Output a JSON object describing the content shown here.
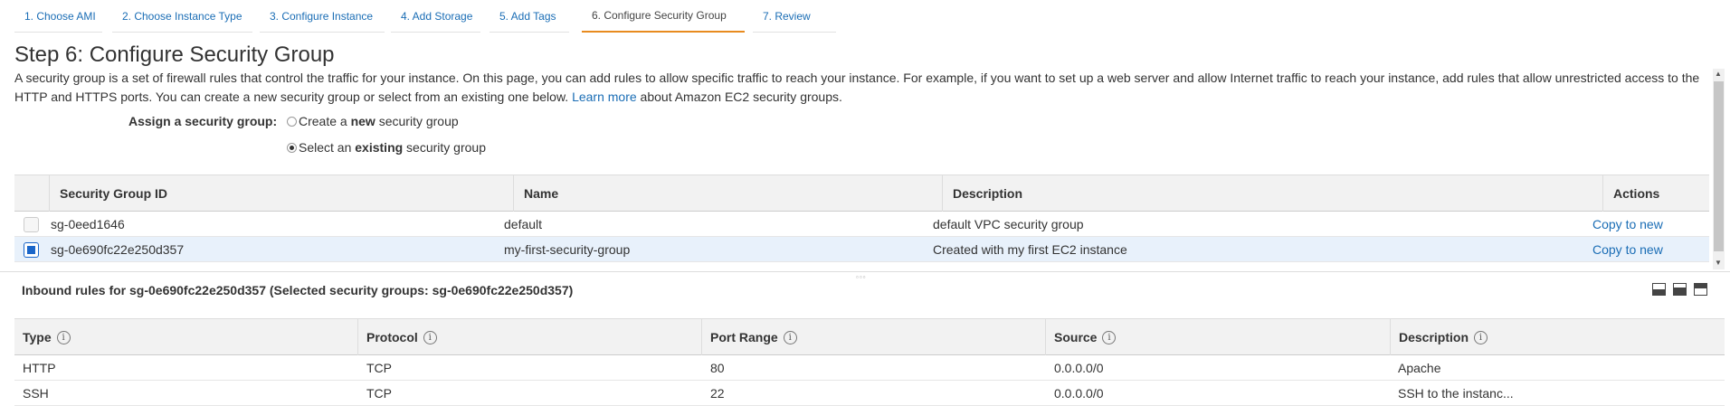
{
  "wizard": {
    "tabs": [
      {
        "label": "1. Choose AMI",
        "active": false
      },
      {
        "label": "2. Choose Instance Type",
        "active": false
      },
      {
        "label": "3. Configure Instance",
        "active": false
      },
      {
        "label": "4. Add Storage",
        "active": false
      },
      {
        "label": "5. Add Tags",
        "active": false
      },
      {
        "label": "6. Configure Security Group",
        "active": true
      },
      {
        "label": "7. Review",
        "active": false
      }
    ]
  },
  "page": {
    "title": "Step 6: Configure Security Group",
    "description_part1": "A security group is a set of firewall rules that control the traffic for your instance. On this page, you can add rules to allow specific traffic to reach your instance. For example, if you want to set up a web server and allow Internet traffic to reach your instance, add rules that allow unrestricted access to the HTTP and HTTPS ports. You can create a new security group or select from an existing one below.",
    "learn_more": "Learn more",
    "description_part2": "about Amazon EC2 security groups."
  },
  "assign": {
    "label": "Assign a security group:",
    "option_new_pre": "Create a ",
    "option_new_bold": "new",
    "option_new_post": " security group",
    "option_existing_pre": "Select an ",
    "option_existing_bold": "existing",
    "option_existing_post": " security group",
    "selected": "existing"
  },
  "security_groups": {
    "columns": {
      "id": "Security Group ID",
      "name": "Name",
      "description": "Description",
      "actions": "Actions"
    },
    "rows": [
      {
        "id": "sg-0eed1646",
        "name": "default",
        "description": "default VPC security group",
        "action": "Copy to new",
        "checked": false
      },
      {
        "id": "sg-0e690fc22e250d357",
        "name": "my-first-security-group",
        "description": "Created with my first EC2 instance",
        "action": "Copy to new",
        "checked": true
      }
    ]
  },
  "inbound": {
    "title": "Inbound rules for sg-0e690fc22e250d357 (Selected security groups: sg-0e690fc22e250d357)",
    "columns": {
      "type": "Type",
      "protocol": "Protocol",
      "port_range": "Port Range",
      "source": "Source",
      "description": "Description"
    },
    "info_glyph": "i",
    "rows": [
      {
        "type": "HTTP",
        "protocol": "TCP",
        "port_range": "80",
        "source": "0.0.0.0/0",
        "description": "Apache"
      },
      {
        "type": "SSH",
        "protocol": "TCP",
        "port_range": "22",
        "source": "0.0.0.0/0",
        "description": "SSH to the instanc..."
      }
    ]
  }
}
